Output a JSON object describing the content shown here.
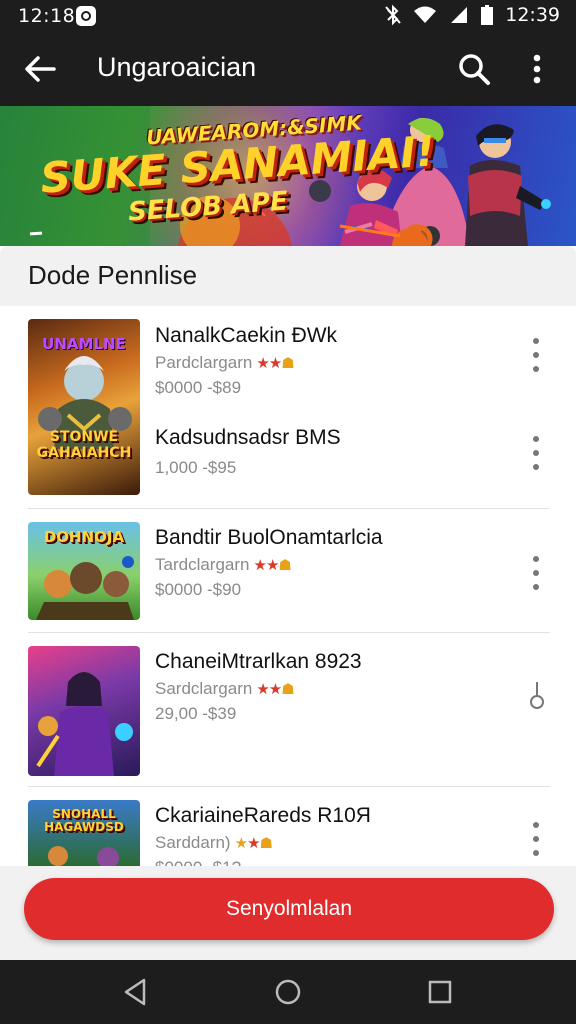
{
  "status_bar": {
    "time_left": "12:18",
    "time_right": "12:39"
  },
  "app_bar": {
    "title": "Ungaroaician"
  },
  "banner": {
    "line1": "UAWEAROM:&SIMK",
    "line2": "SUKE SANAMIAI!",
    "line3": "SELOB APE"
  },
  "section": {
    "title": "Dode Pennlise"
  },
  "items": [
    {
      "name": "NanalkCaekin ÐWk",
      "sub": "Pardclargarn",
      "price": "$0000 -$89",
      "thumb_top": "UNAMLNE",
      "thumb_bottom": "STONWE GAHAIAHCH"
    },
    {
      "name": "Kadsudnsadsr BMS",
      "sub": "",
      "price": "1,000 -$95"
    },
    {
      "name": "Bandtir BuolOnamtarlcia",
      "sub": "Tardclargarn",
      "price": "$0000 -$90",
      "thumb_top": "DOHNOJA"
    },
    {
      "name": "ChaneiMtrarlkan 8923",
      "sub": "Sardclargarn",
      "price": "29,00 -$39"
    },
    {
      "name": "CkariaineRareds R10Я",
      "sub": "Sarddarn)",
      "price": "$0000 -$1?",
      "thumb_top": "SNOHALL HAGAWDSD"
    }
  ],
  "cta": {
    "label": "Senyolmlalan"
  },
  "colors": {
    "accent": "#e02c2c",
    "bar": "#1d1d1d",
    "star": "#e8a21a"
  }
}
